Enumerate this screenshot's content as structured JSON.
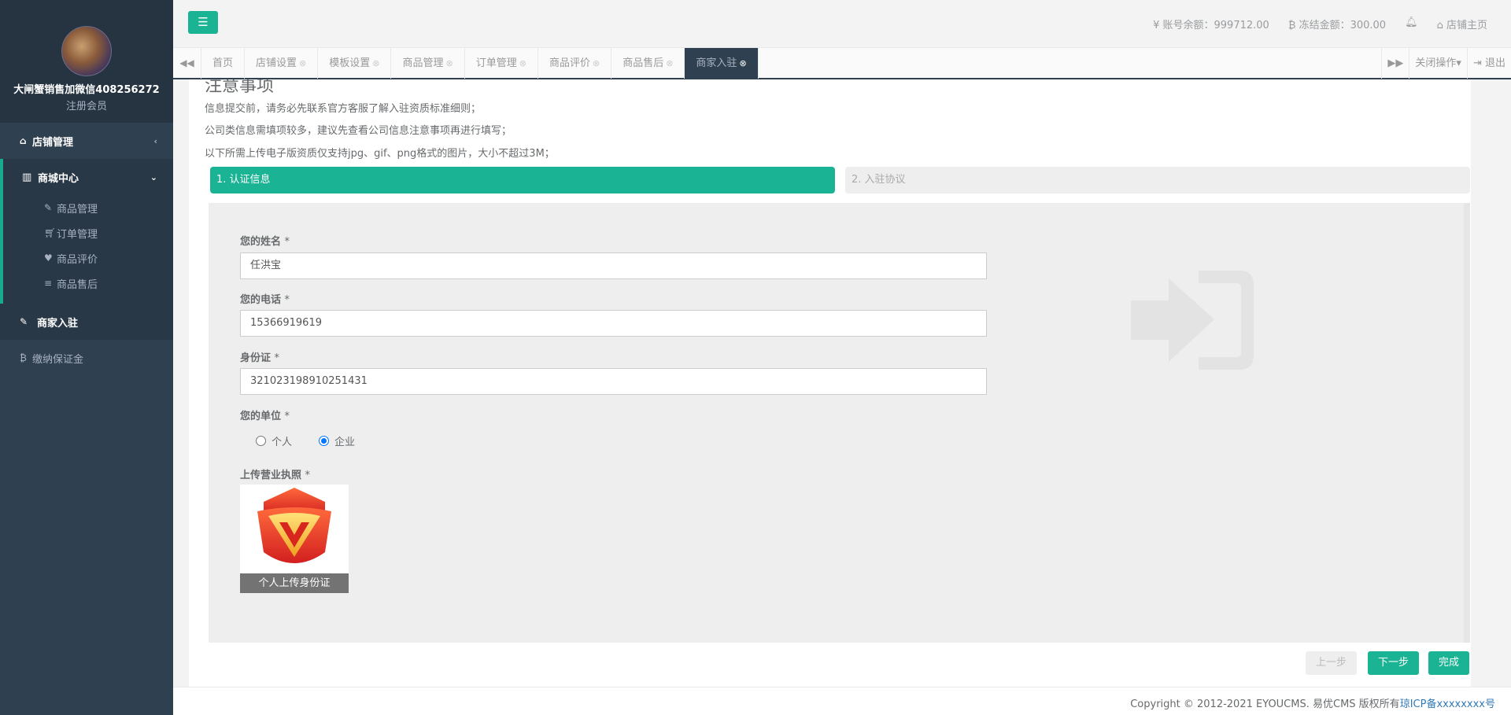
{
  "sidebar": {
    "profile": {
      "name": "大闸蟹销售加微信408256272",
      "role": "注册会员"
    },
    "items": [
      {
        "label": "店铺管理",
        "icon": "home-icon"
      },
      {
        "label": "商城中心",
        "icon": "bar-chart-icon",
        "expanded": true,
        "children": [
          {
            "label": "商品管理",
            "icon": "edit-icon"
          },
          {
            "label": "订单管理",
            "icon": "cart-icon"
          },
          {
            "label": "商品评价",
            "icon": "heart-icon"
          },
          {
            "label": "商品售后",
            "icon": "database-icon"
          }
        ]
      },
      {
        "label": "商家入驻",
        "icon": "edit-icon",
        "active": true
      },
      {
        "label": "缴纳保证金",
        "icon": "bitcoin-icon"
      }
    ]
  },
  "header": {
    "balance_label": "账号余额：999712.00",
    "frozen_label": "冻结金额：300.00",
    "shop_home": "店铺主页"
  },
  "tabs": [
    "首页",
    "店铺设置",
    "模板设置",
    "商品管理",
    "订单管理",
    "商品评价",
    "商品售后",
    "商家入驻"
  ],
  "tab_controls": {
    "close_ops": "关闭操作",
    "logout": "退出"
  },
  "notice": {
    "title": "注意事项",
    "lines": [
      "信息提交前，请务必先联系官方客服了解入驻资质标准细则；",
      "公司类信息需填项较多，建议先查看公司信息注意事项再进行填写；",
      "以下所需上传电子版资质仅支持jpg、gif、png格式的图片，大小不超过3M；"
    ]
  },
  "steps": [
    "1. 认证信息",
    "2. 入驻协议"
  ],
  "form": {
    "name_label": "您的姓名",
    "name_value": "任洪宝",
    "phone_label": "您的电话",
    "phone_value": "15366919619",
    "id_label": "身份证",
    "id_value": "321023198910251431",
    "unit_label": "您的单位",
    "unit_options": [
      "个人",
      "企业"
    ],
    "unit_selected": "企业",
    "upload_label": "上传营业执照",
    "upload_caption": "个人上传身份证",
    "required_mark": "*"
  },
  "buttons": {
    "prev": "上一步",
    "next": "下一步",
    "done": "完成"
  },
  "footer": {
    "copyright": "Copyright © 2012-2021 EYOUCMS. 易优CMS 版权所有",
    "icp": "琼ICP备xxxxxxxx号"
  },
  "colors": {
    "accent": "#1ab394",
    "sidebar": "#2f4050",
    "sidebar_dark": "#263442"
  }
}
